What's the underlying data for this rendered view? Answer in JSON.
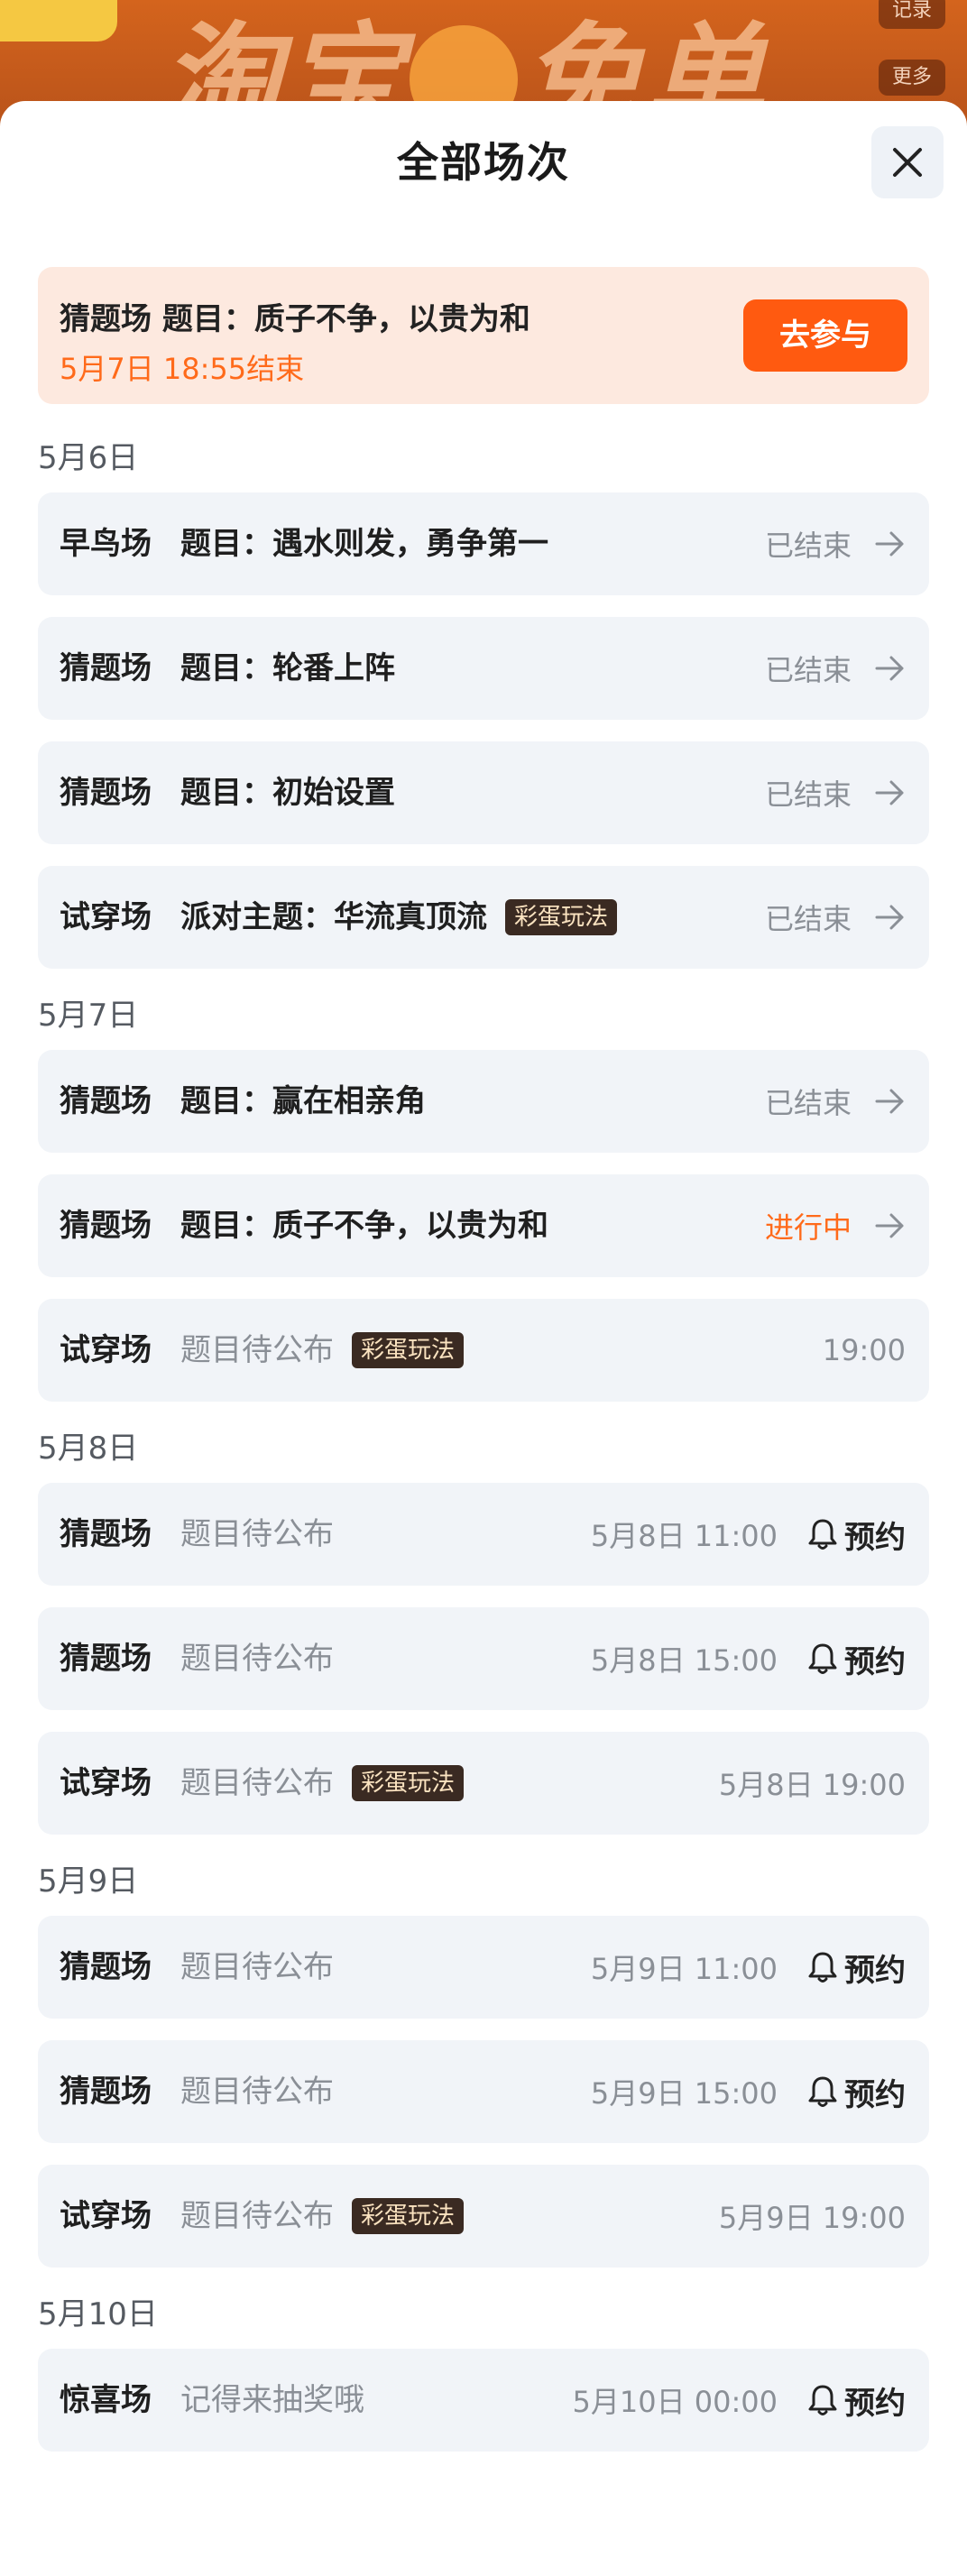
{
  "background": {
    "logo_text": "淘宝 免单",
    "btn_record": "记录",
    "btn_more": "更多"
  },
  "sheet": {
    "title": "全部场次"
  },
  "highlight": {
    "title": "猜题场   题目：质子不争，以贵为和",
    "subtitle": "5月7日 18:55结束",
    "button": "去参与"
  },
  "groups": [
    {
      "date": "5月6日",
      "rows": [
        {
          "type": "早鸟场",
          "topic": "题目：遇水则发，勇争第一",
          "tag": "",
          "muted": false,
          "status": "已结束",
          "status_kind": "ended",
          "time": "",
          "reserve": ""
        },
        {
          "type": "猜题场",
          "topic": "题目：轮番上阵",
          "tag": "",
          "muted": false,
          "status": "已结束",
          "status_kind": "ended",
          "time": "",
          "reserve": ""
        },
        {
          "type": "猜题场",
          "topic": "题目：初始设置",
          "tag": "",
          "muted": false,
          "status": "已结束",
          "status_kind": "ended",
          "time": "",
          "reserve": ""
        },
        {
          "type": "试穿场",
          "topic": "派对主题：华流真顶流",
          "tag": "彩蛋玩法",
          "muted": false,
          "status": "已结束",
          "status_kind": "ended",
          "time": "",
          "reserve": ""
        }
      ]
    },
    {
      "date": "5月7日",
      "rows": [
        {
          "type": "猜题场",
          "topic": "题目：赢在相亲角",
          "tag": "",
          "muted": false,
          "status": "已结束",
          "status_kind": "ended",
          "time": "",
          "reserve": ""
        },
        {
          "type": "猜题场",
          "topic": "题目：质子不争，以贵为和",
          "tag": "",
          "muted": false,
          "status": "进行中",
          "status_kind": "live",
          "time": "",
          "reserve": ""
        },
        {
          "type": "试穿场",
          "topic": "题目待公布",
          "tag": "彩蛋玩法",
          "muted": true,
          "status": "",
          "status_kind": "",
          "time": "19:00",
          "reserve": ""
        }
      ]
    },
    {
      "date": "5月8日",
      "rows": [
        {
          "type": "猜题场",
          "topic": "题目待公布",
          "tag": "",
          "muted": true,
          "status": "",
          "status_kind": "",
          "time": "5月8日 11:00",
          "reserve": "预约"
        },
        {
          "type": "猜题场",
          "topic": "题目待公布",
          "tag": "",
          "muted": true,
          "status": "",
          "status_kind": "",
          "time": "5月8日 15:00",
          "reserve": "预约"
        },
        {
          "type": "试穿场",
          "topic": "题目待公布",
          "tag": "彩蛋玩法",
          "muted": true,
          "status": "",
          "status_kind": "",
          "time": "5月8日 19:00",
          "reserve": ""
        }
      ]
    },
    {
      "date": "5月9日",
      "rows": [
        {
          "type": "猜题场",
          "topic": "题目待公布",
          "tag": "",
          "muted": true,
          "status": "",
          "status_kind": "",
          "time": "5月9日 11:00",
          "reserve": "预约"
        },
        {
          "type": "猜题场",
          "topic": "题目待公布",
          "tag": "",
          "muted": true,
          "status": "",
          "status_kind": "",
          "time": "5月9日 15:00",
          "reserve": "预约"
        },
        {
          "type": "试穿场",
          "topic": "题目待公布",
          "tag": "彩蛋玩法",
          "muted": true,
          "status": "",
          "status_kind": "",
          "time": "5月9日 19:00",
          "reserve": ""
        }
      ]
    },
    {
      "date": "5月10日",
      "rows": [
        {
          "type": "惊喜场",
          "topic": "记得来抽奖哦",
          "tag": "",
          "muted": true,
          "status": "",
          "status_kind": "",
          "time": "5月10日 00:00",
          "reserve": "预约"
        }
      ]
    }
  ],
  "colors": {
    "accent": "#ff5a10",
    "live": "#ff6a1a",
    "row_bg": "#f1f4f8",
    "highlight_bg": "#fde9df",
    "tag_bg": "#3a2a22"
  },
  "icons": {
    "close": "close-icon",
    "arrow": "arrow-right-icon",
    "bell": "bell-icon"
  }
}
